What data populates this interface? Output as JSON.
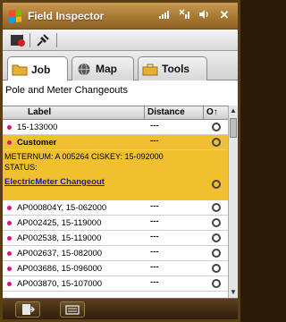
{
  "window": {
    "title": "Field Inspector",
    "status_icons": [
      "signal-icon",
      "no-signal-icon",
      "speaker-icon"
    ],
    "close_label": "✕"
  },
  "toolbar": {
    "icons": [
      "record-icon",
      "pushpin-icon"
    ]
  },
  "tabs": [
    {
      "label": "Job",
      "icon": "folder-icon",
      "active": true
    },
    {
      "label": "Map",
      "icon": "globe-icon",
      "active": false
    },
    {
      "label": "Tools",
      "icon": "toolbox-icon",
      "active": false
    }
  ],
  "main": {
    "section_title": "Pole and Meter Changeouts",
    "columns": [
      "Label",
      "Distance",
      "O↑"
    ],
    "first_row": {
      "label": "15-133000",
      "distance": "---"
    },
    "selected": {
      "label": "Customer",
      "distance": "---",
      "meter_line": "METERNUM: A 005264    CISKEY: 15-092000",
      "status_line": "STATUS:",
      "link": "ElectricMeter Changeout"
    },
    "rows": [
      {
        "label": "AP000804Y, 15-062000",
        "distance": "---"
      },
      {
        "label": "AP002425, 15-119000",
        "distance": "---"
      },
      {
        "label": "AP002538, 15-119000",
        "distance": "---"
      },
      {
        "label": "AP002637, 15-082000",
        "distance": "---"
      },
      {
        "label": "AP003686, 15-096000",
        "distance": "---"
      },
      {
        "label": "AP003870, 15-107000",
        "distance": "---"
      }
    ]
  },
  "colors": {
    "titlebar": "#b08238",
    "highlight": "#f0c02e",
    "marker": "#d4147a",
    "link": "#1a1aa0"
  }
}
